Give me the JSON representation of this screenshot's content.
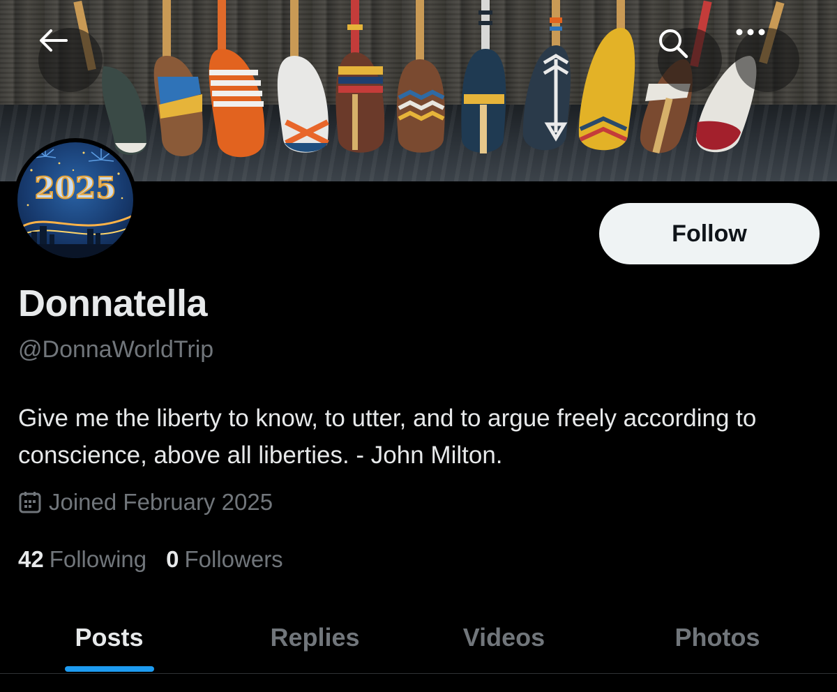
{
  "profile": {
    "display_name": "Donnatella",
    "handle": "@DonnaWorldTrip",
    "bio": "Give me the liberty to know, to utter, and to argue freely according to conscience, above all liberties. - John Milton.",
    "joined": "Joined February 2025",
    "avatar_text": "2025"
  },
  "actions": {
    "follow_label": "Follow"
  },
  "stats": {
    "following_count": "42",
    "following_label": "Following",
    "followers_count": "0",
    "followers_label": "Followers"
  },
  "tabs": [
    {
      "label": "Posts",
      "active": true
    },
    {
      "label": "Replies",
      "active": false
    },
    {
      "label": "Videos",
      "active": false
    },
    {
      "label": "Photos",
      "active": false
    }
  ],
  "icons": {
    "back": "arrow-left-icon",
    "search": "search-icon",
    "more": "more-horizontal-icon",
    "joined": "calendar-icon"
  },
  "colors": {
    "background": "#000000",
    "primary_text": "#e7e9ea",
    "secondary_text": "#71767b",
    "accent": "#1d9bf0",
    "follow_button": "#eff3f4"
  }
}
